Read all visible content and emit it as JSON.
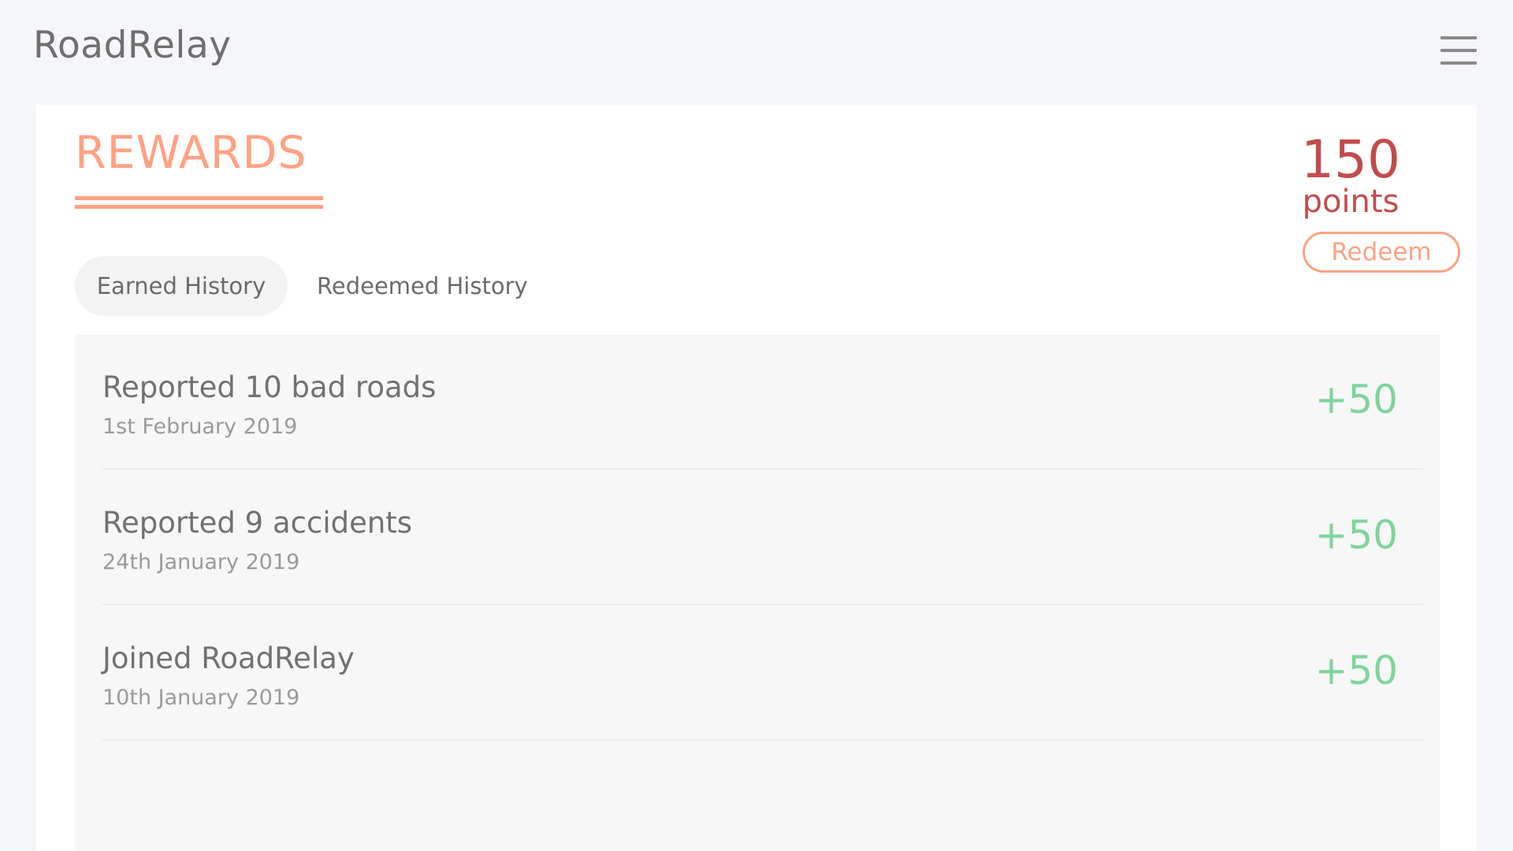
{
  "app": {
    "brand": "RoadRelay",
    "menu_icon": "hamburger-menu-icon"
  },
  "rewards": {
    "title": "REWARDS",
    "points_value": "150",
    "points_label": "points",
    "redeem_label": "Redeem"
  },
  "tabs": [
    {
      "label": "Earned History",
      "active": true
    },
    {
      "label": "Redeemed History",
      "active": false
    }
  ],
  "history": [
    {
      "title": "Reported 10 bad roads",
      "date": "1st February 2019",
      "points": "+50"
    },
    {
      "title": "Reported 9 accidents",
      "date": "24th January 2019",
      "points": "+50"
    },
    {
      "title": "Joined RoadRelay",
      "date": "10th January 2019",
      "points": "+50"
    }
  ],
  "colors": {
    "accent": "#ffa283",
    "points": "#c24c4c",
    "positive": "#7fd59a",
    "background": "#f5f6f9"
  }
}
